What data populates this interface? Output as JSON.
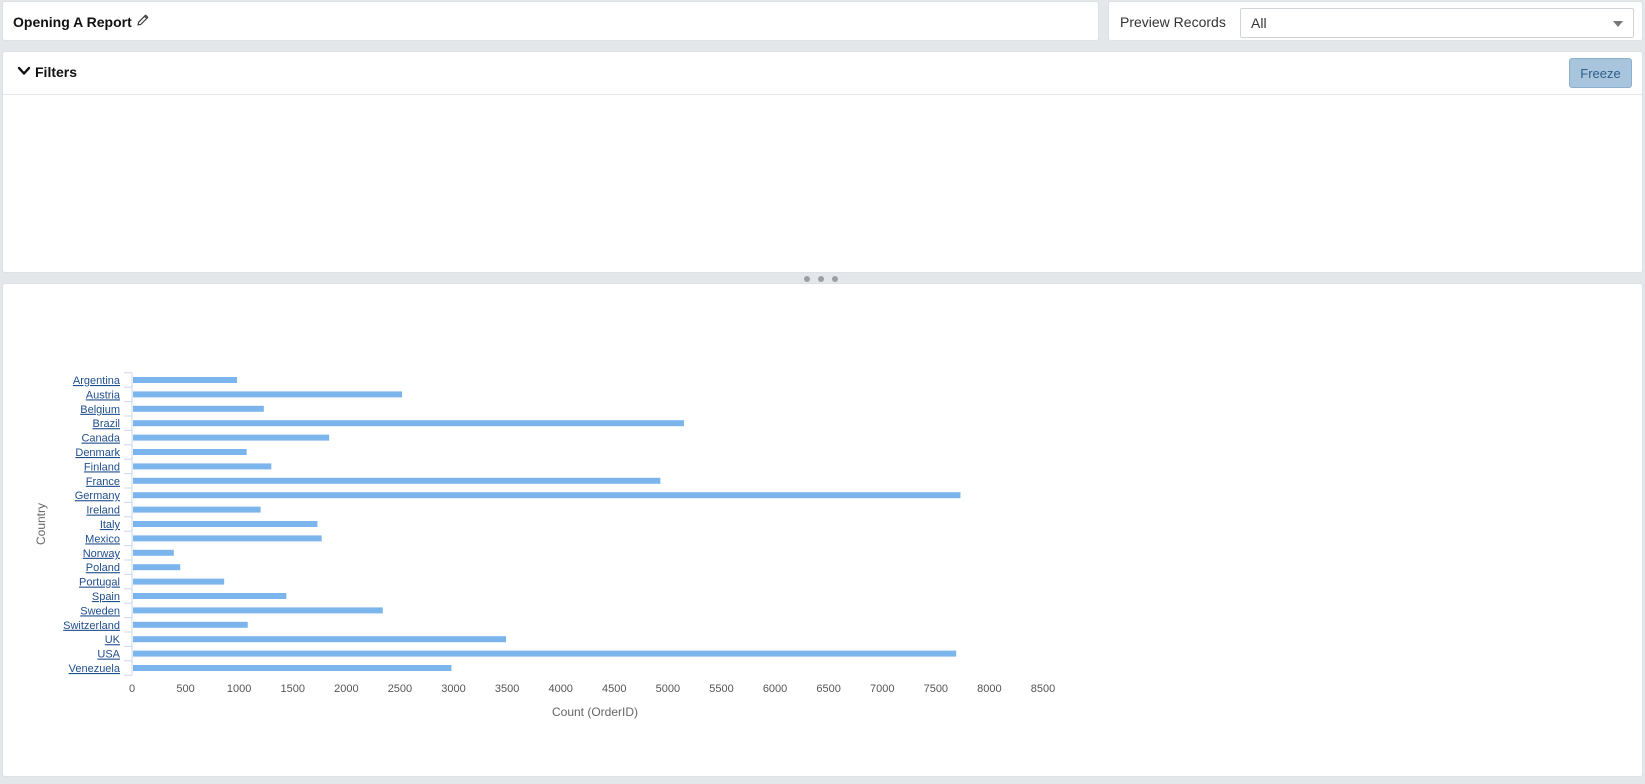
{
  "header": {
    "title": "Opening A Report",
    "edit_icon": "pencil-icon"
  },
  "preview": {
    "label": "Preview Records",
    "selected": "All"
  },
  "filters": {
    "label": "Filters",
    "toggle_icon": "chevron-down-icon",
    "freeze_label": "Freeze"
  },
  "colors": {
    "bar": "#7cb5ec",
    "link": "#1f4e8c",
    "freeze_bg": "#a9c4dd"
  },
  "chart_data": {
    "type": "bar",
    "orientation": "horizontal",
    "categories": [
      "Argentina",
      "Austria",
      "Belgium",
      "Brazil",
      "Canada",
      "Denmark",
      "Finland",
      "France",
      "Germany",
      "Ireland",
      "Italy",
      "Mexico",
      "Norway",
      "Poland",
      "Portugal",
      "Spain",
      "Sweden",
      "Switzerland",
      "UK",
      "USA",
      "Venezuela"
    ],
    "values": [
      980,
      2520,
      1230,
      5150,
      1840,
      1070,
      1300,
      4930,
      7730,
      1200,
      1730,
      1770,
      390,
      450,
      860,
      1440,
      2340,
      1080,
      3490,
      7690,
      2980
    ],
    "xlabel": "Count (OrderID)",
    "ylabel": "Country",
    "xlim": [
      0,
      8500
    ],
    "xticks": [
      0,
      500,
      1000,
      1500,
      2000,
      2500,
      3000,
      3500,
      4000,
      4500,
      5000,
      5500,
      6000,
      6500,
      7000,
      7500,
      8000,
      8500
    ],
    "grid": false,
    "legend": "none"
  }
}
